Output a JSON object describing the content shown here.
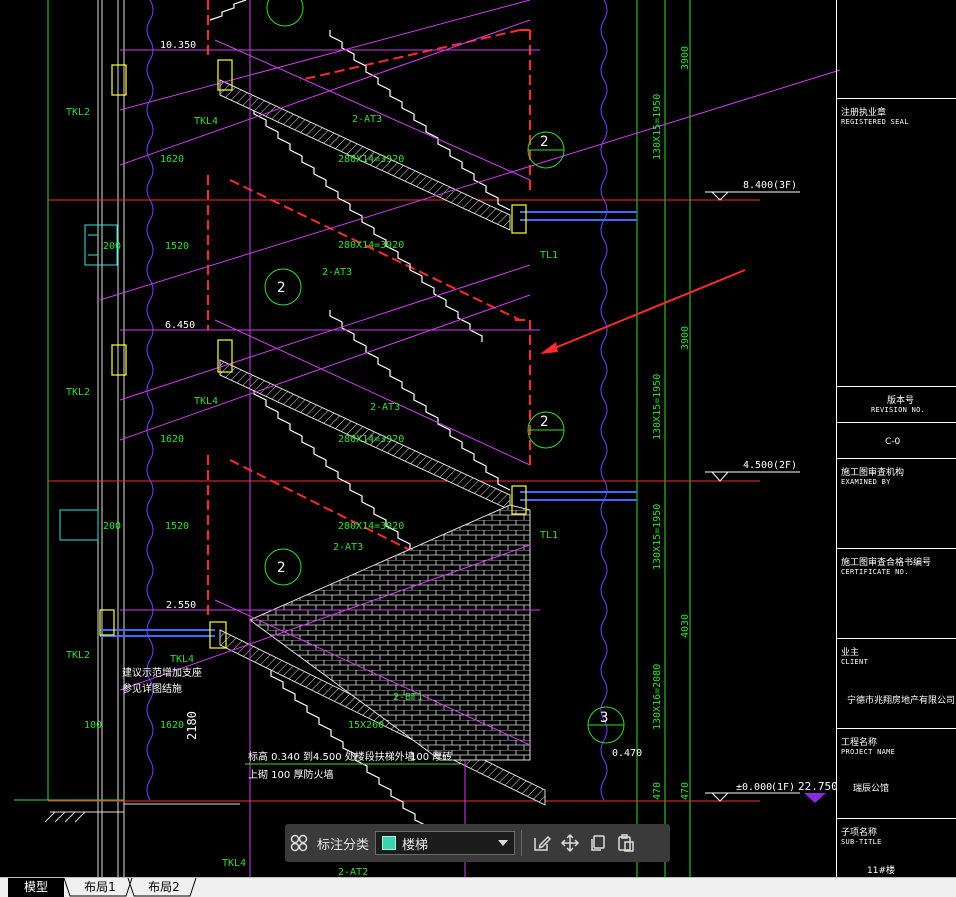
{
  "drawing": {
    "colors": {
      "green": "#2fe02f",
      "magenta": "#d23cf0",
      "red": "#ff2a2a",
      "white": "#ffffff",
      "yellow": "#ffff33",
      "cyan": "#27e7e7",
      "blue": "#3c6cff"
    },
    "elevations": {
      "e10350": "10.350",
      "e6450": "6.450",
      "e2550": "2.550",
      "e8400": "8.400",
      "f3": "(3F)",
      "e4500": "4.500",
      "f2": "(2F)",
      "e0000": "±0.000",
      "f1": "(1F)",
      "e0470": "0.470",
      "e22750": "22.750"
    },
    "labels": {
      "tkl2": "TKL2",
      "tkl4": "TKL4",
      "tl1": "TL1",
      "at3": "2-AT3",
      "bt1": "2-BT1",
      "step_280x14": "280X14=3920",
      "step_15x260": "15X260",
      "d1620": "1620",
      "d1520": "1520",
      "d200": "200",
      "d100": "100",
      "d2180": "2180",
      "d470": "470",
      "d3900": "3900",
      "d4030": "4030",
      "d130x15": "130X15=1950",
      "d130x16": "130X16=2080",
      "callout2": "2",
      "callout3": "3",
      "note1": "标高 0.340 到4.500 处楼段扶梯外墙",
      "note1b": "100 厚砖",
      "note2": "上砌 100 厚防火墙",
      "note3": "建议示范增加支座",
      "note4": "参见详图结施"
    }
  },
  "title_block": {
    "registered_seal_cn": "注册执业章",
    "registered_seal_en": "REGISTERED SEAL",
    "revision_cn": "版本号",
    "revision_en": "REVISION NO.",
    "revision_val": "C-0",
    "examined_cn": "施工图审查机构",
    "examined_en": "EXAMINED BY",
    "certificate_cn": "施工图审查合格书编号",
    "certificate_en": "CERTIFICATE NO.",
    "client_cn": "业主",
    "client_en": "CLIENT",
    "client_val": "宁德市兆翔房地产有限公司",
    "project_cn": "工程名称",
    "project_en": "PROJECT NAME",
    "project_val": "瑞辰公馆",
    "subtitle_cn": "子项名称",
    "subtitle_en": "SUB-TITLE",
    "subtitle_val": "11#楼"
  },
  "toolbar": {
    "grid_icon": "grid-icon",
    "label": "标注分类",
    "category_value": "楼梯",
    "category_color": "#3ad5b0",
    "icons": [
      "edit-icon",
      "move-icon",
      "copy-icon",
      "paste-icon"
    ]
  },
  "tabs": [
    {
      "label": "模型",
      "active": true
    },
    {
      "label": "布局1",
      "active": false
    },
    {
      "label": "布局2",
      "active": false
    }
  ]
}
